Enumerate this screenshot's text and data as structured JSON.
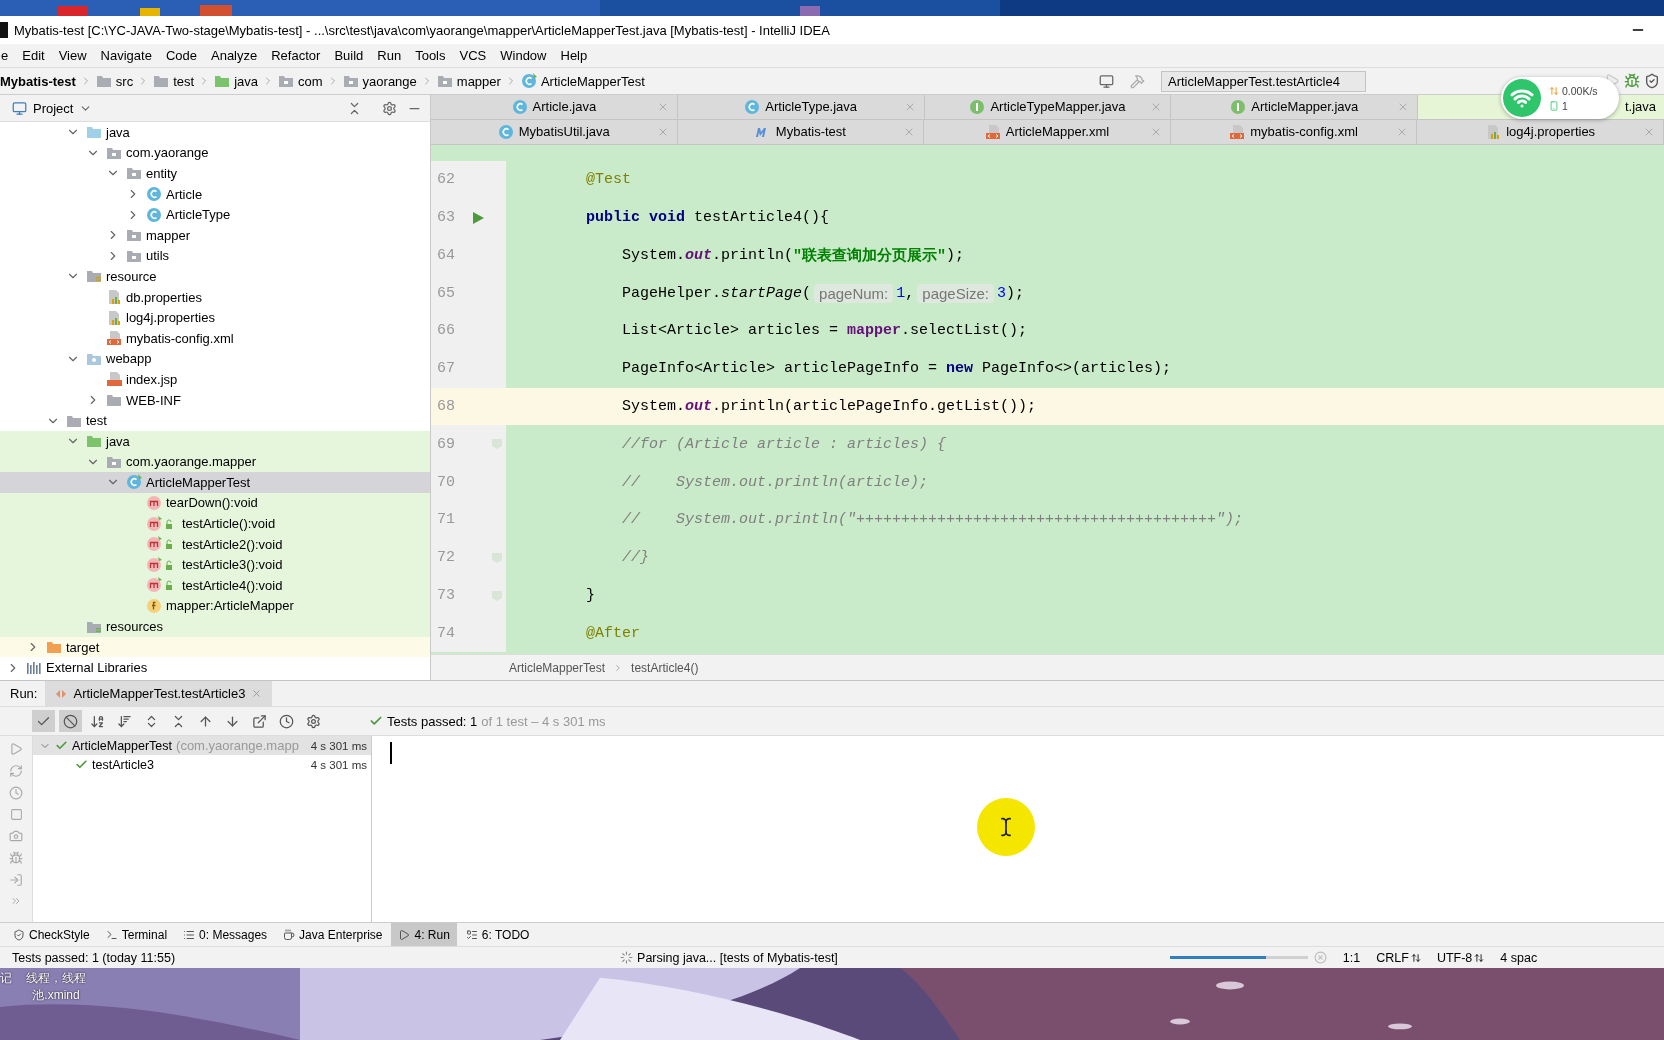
{
  "desktop_labels": [
    "记",
    "线程，线程",
    "池.xmind"
  ],
  "window": {
    "title": "Mybatis-test [C:\\YC-JAVA-Two-stage\\Mybatis-test] - ...\\src\\test\\java\\com\\yaorange\\mapper\\ArticleMapperTest.java [Mybatis-test] - IntelliJ IDEA"
  },
  "menu": [
    "e",
    "Edit",
    "View",
    "Navigate",
    "Code",
    "Analyze",
    "Refactor",
    "Build",
    "Run",
    "Tools",
    "VCS",
    "Window",
    "Help"
  ],
  "nav": {
    "crumbs": [
      {
        "label": "Mybatis-test",
        "kind": "project"
      },
      {
        "label": "src",
        "kind": "folder"
      },
      {
        "label": "test",
        "kind": "folder"
      },
      {
        "label": "java",
        "kind": "test-folder"
      },
      {
        "label": "com",
        "kind": "package"
      },
      {
        "label": "yaorange",
        "kind": "package"
      },
      {
        "label": "mapper",
        "kind": "package"
      },
      {
        "label": "ArticleMapperTest",
        "kind": "test-class"
      }
    ],
    "run_config": "ArticleMapperTest.testArticle4"
  },
  "project_panel": {
    "title": "Project",
    "tree": [
      {
        "children": [
          {
            "children": [
              {
                "children": [
                  {
                    "label": "java",
                    "kind": "source-folder",
                    "expanded": true,
                    "selected": false,
                    "children": [
                      {
                        "label": "com.yaorange",
                        "kind": "package",
                        "expanded": true,
                        "selected": false,
                        "children": [
                          {
                            "label": "entity",
                            "kind": "package",
                            "expanded": true,
                            "selected": false,
                            "children": [
                              {
                                "label": "Article",
                                "kind": "class",
                                "expanded": false,
                                "selected": false
                              },
                              {
                                "label": "ArticleType",
                                "kind": "class",
                                "expanded": false,
                                "selected": false
                              }
                            ]
                          },
                          {
                            "label": "mapper",
                            "kind": "package",
                            "expanded": false,
                            "selected": false
                          },
                          {
                            "label": "utils",
                            "kind": "package",
                            "expanded": false,
                            "selected": false
                          }
                        ]
                      }
                    ]
                  },
                  {
                    "label": "resource",
                    "kind": "resource-folder",
                    "expanded": true,
                    "selected": false,
                    "children": [
                      {
                        "label": "db.properties",
                        "kind": "properties",
                        "selected": false
                      },
                      {
                        "label": "log4j.properties",
                        "kind": "properties",
                        "selected": false
                      },
                      {
                        "label": "mybatis-config.xml",
                        "kind": "xml",
                        "selected": false
                      }
                    ]
                  },
                  {
                    "label": "webapp",
                    "kind": "web-folder",
                    "expanded": true,
                    "selected": false,
                    "children": [
                      {
                        "label": "index.jsp",
                        "kind": "jsp",
                        "selected": false
                      },
                      {
                        "label": "WEB-INF",
                        "kind": "folder",
                        "expanded": false,
                        "selected": false
                      }
                    ]
                  }
                ]
              },
              {
                "label": "test",
                "kind": "folder",
                "expanded": true,
                "selected": false,
                "children": [
                  {
                    "label": "java",
                    "kind": "test-folder",
                    "expanded": true,
                    "selected": false,
                    "test_scope": true,
                    "children": [
                      {
                        "label": "com.yaorange.mapper",
                        "kind": "package",
                        "expanded": true,
                        "selected": false,
                        "children": [
                          {
                            "label": "ArticleMapperTest",
                            "kind": "test-class",
                            "expanded": true,
                            "selected": true,
                            "children": [
                              {
                                "label": "tearDown():void",
                                "kind": "method",
                                "selected": false
                              },
                              {
                                "label": "testArticle():void",
                                "kind": "test-method",
                                "selected": false
                              },
                              {
                                "label": "testArticle2():void",
                                "kind": "test-method",
                                "selected": false
                              },
                              {
                                "label": "testArticle3():void",
                                "kind": "test-method",
                                "selected": false
                              },
                              {
                                "label": "testArticle4():void",
                                "kind": "test-method",
                                "selected": false
                              },
                              {
                                "label": "mapper:ArticleMapper",
                                "kind": "field",
                                "selected": false
                              }
                            ]
                          }
                        ]
                      }
                    ]
                  },
                  {
                    "label": "resources",
                    "kind": "test-resource-folder",
                    "selected": false,
                    "test_scope": true
                  }
                ]
              }
            ]
          },
          {
            "label": "target",
            "kind": "excluded-folder",
            "expanded": false,
            "selected": false,
            "excluded": true
          }
        ]
      },
      {
        "label": "External Libraries",
        "kind": "library",
        "expanded": false,
        "selected": false
      }
    ]
  },
  "editor": {
    "tab_rows": [
      [
        {
          "label": "Article.java",
          "kind": "class",
          "selected": false
        },
        {
          "label": "ArticleType.java",
          "kind": "class",
          "selected": false
        },
        {
          "label": "ArticleTypeMapper.java",
          "kind": "interface",
          "selected": false
        },
        {
          "label": "ArticleMapper.java",
          "kind": "interface",
          "selected": false
        },
        {
          "label": "t.java",
          "selected": true
        }
      ],
      [
        {
          "label": "MybatisUtil.java",
          "kind": "class",
          "selected": false
        },
        {
          "label": "Mybatis-test",
          "kind": "module",
          "selected": false
        },
        {
          "label": "ArticleMapper.xml",
          "kind": "xml",
          "selected": false
        },
        {
          "label": "mybatis-config.xml",
          "kind": "xml",
          "selected": false
        },
        {
          "label": "log4j.properties",
          "kind": "properties",
          "selected": false
        }
      ]
    ],
    "lines": [
      {
        "number": "62",
        "current": false,
        "segments": [
          {
            "kind": "annotation",
            "t": "    @Test"
          }
        ]
      },
      {
        "number": "63",
        "current": false,
        "run_marker": true,
        "segments": [
          {
            "kind": "keyword",
            "t": "    public void"
          },
          {
            "kind": "plain",
            "t": " testArticle4(){"
          }
        ]
      },
      {
        "number": "64",
        "current": false,
        "segments": [
          {
            "kind": "plain",
            "t": "        System."
          },
          {
            "kind": "static",
            "t": "out"
          },
          {
            "kind": "plain",
            "t": ".println("
          },
          {
            "kind": "string",
            "t": "\"联表查询加分页展示\""
          },
          {
            "kind": "plain",
            "t": ");"
          }
        ]
      },
      {
        "number": "65",
        "current": false,
        "segments": [
          {
            "kind": "plain",
            "t": "        PageHelper."
          },
          {
            "kind": "call",
            "t": "startPage"
          },
          {
            "kind": "plain",
            "t": "("
          },
          {
            "kind": "hint",
            "t": "pageNum:"
          },
          {
            "kind": "number",
            "t": "1"
          },
          {
            "kind": "plain",
            "t": ","
          },
          {
            "kind": "hint",
            "t": "pageSize:"
          },
          {
            "kind": "number",
            "t": "3"
          },
          {
            "kind": "plain",
            "t": ");"
          }
        ]
      },
      {
        "number": "66",
        "current": false,
        "segments": [
          {
            "kind": "plain",
            "t": "        List<Article> articles = "
          },
          {
            "kind": "field",
            "t": "mapper"
          },
          {
            "kind": "plain",
            "t": ".selectList();"
          }
        ]
      },
      {
        "number": "67",
        "current": false,
        "segments": [
          {
            "kind": "plain",
            "t": "        PageInfo<Article> articlePageInfo = "
          },
          {
            "kind": "keyword",
            "t": "new"
          },
          {
            "kind": "plain",
            "t": " PageInfo<>(articles);"
          }
        ]
      },
      {
        "number": "68",
        "current": true,
        "segments": [
          {
            "kind": "plain",
            "t": "        System."
          },
          {
            "kind": "static",
            "t": "out"
          },
          {
            "kind": "plain",
            "t": ".println(articlePageInfo.getList());"
          }
        ]
      },
      {
        "number": "69",
        "current": false,
        "fold_marker": true,
        "segments": [
          {
            "kind": "comment",
            "t": "        //for (Article article : articles) {"
          }
        ]
      },
      {
        "number": "70",
        "current": false,
        "segments": [
          {
            "kind": "comment",
            "t": "        //    System.out.println(article);"
          }
        ]
      },
      {
        "number": "71",
        "current": false,
        "segments": [
          {
            "kind": "comment",
            "t": "        //    System.out.println(\"++++++++++++++++++++++++++++++++++++++++\");"
          }
        ]
      },
      {
        "number": "72",
        "current": false,
        "fold_marker": true,
        "segments": [
          {
            "kind": "comment",
            "t": "        //}"
          }
        ]
      },
      {
        "number": "73",
        "current": false,
        "fold_marker": true,
        "segments": [
          {
            "kind": "plain",
            "t": "    }"
          }
        ]
      },
      {
        "number": "74",
        "current": false,
        "segments": [
          {
            "kind": "annotation",
            "t": "    @After"
          }
        ]
      }
    ],
    "breadcrumb": [
      "ArticleMapperTest",
      "testArticle4()"
    ]
  },
  "run": {
    "label": "Run:",
    "tab": "ArticleMapperTest.testArticle3",
    "toolbar": [
      {
        "kind": "show-passed",
        "on": true
      },
      {
        "kind": "show-ignored",
        "on": true
      },
      {
        "kind": "sort-alpha",
        "on": false
      },
      {
        "kind": "sort-duration",
        "on": false
      },
      {
        "kind": "expand-all",
        "on": false
      },
      {
        "kind": "collapse-all",
        "on": false
      },
      {
        "kind": "previous",
        "on": false
      },
      {
        "kind": "next",
        "on": false
      },
      {
        "kind": "export",
        "on": false
      },
      {
        "kind": "history",
        "on": false
      },
      {
        "kind": "settings",
        "on": false
      }
    ],
    "summary": {
      "passed": "Tests passed: 1",
      "detail": "of 1 test – 4 s 301 ms"
    },
    "tests": [
      {
        "name": "ArticleMapperTest",
        "detail": "(com.yaorange.mapp",
        "time": "4 s 301 ms",
        "selected": true,
        "children": [
          {
            "name": "testArticle3",
            "time": "4 s 301 ms",
            "selected": false
          }
        ]
      }
    ]
  },
  "tool_windows": [
    {
      "label": "CheckStyle",
      "kind": "checkstyle",
      "selected": false
    },
    {
      "label": "Terminal",
      "kind": "terminal",
      "selected": false
    },
    {
      "label": "0: Messages",
      "kind": "messages",
      "selected": false
    },
    {
      "label": "Java Enterprise",
      "kind": "enterprise",
      "selected": false
    },
    {
      "label": "4: Run",
      "kind": "run",
      "selected": true
    },
    {
      "label": "6: TODO",
      "kind": "todo",
      "selected": false
    }
  ],
  "status": {
    "message": "Tests passed: 1 (today 11:55)",
    "task": "Parsing java... [tests of Mybatis-test]",
    "progress": {
      "level": 0.7
    },
    "position": "1:1",
    "line_separator": "CRLF",
    "encoding": "UTF-8",
    "indent": "4 spac"
  },
  "network_widget": {
    "speed": "0.00K/s",
    "count": "1"
  }
}
